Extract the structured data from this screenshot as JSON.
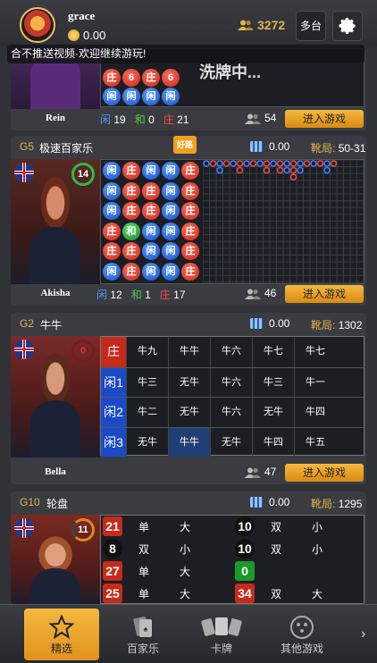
{
  "header": {
    "username": "grace",
    "balance": "0.00",
    "online_count": "3272",
    "multi_table_label": "多台"
  },
  "marquee": "合不推送视频·欢迎继续游玩!",
  "top_card": {
    "banner_text": "洗牌中...",
    "dealer_name": "Rein",
    "player_label": "闲",
    "player_count": "19",
    "tie_label": "和",
    "tie_count": "0",
    "banker_label": "庄",
    "banker_count": "21",
    "players": "54",
    "enter_label": "进入游戏",
    "bead_rows": [
      [
        "庄",
        "6",
        "庄",
        "6"
      ],
      [
        "闲",
        "闲",
        "闲",
        "闲"
      ]
    ]
  },
  "g5": {
    "id": "G5",
    "name": "极速百家乐",
    "badge": "好路",
    "shoe": "0.00",
    "round_label": "靴局:",
    "round": "50-31",
    "dealer_name": "Akisha",
    "timer": "14",
    "player_label": "闲",
    "player_count": "12",
    "tie_label": "和",
    "tie_count": "1",
    "banker_label": "庄",
    "banker_count": "17",
    "players": "46",
    "enter_label": "进入游戏",
    "bead_grid": [
      [
        "闲",
        "庄",
        "闲",
        "闲",
        "庄"
      ],
      [
        "闲",
        "庄",
        "庄",
        "闲",
        "庄"
      ],
      [
        "闲",
        "庄",
        "庄",
        "闲",
        "庄"
      ],
      [
        "庄",
        "和",
        "闲",
        "闲",
        "庄"
      ],
      [
        "庄",
        "庄",
        "闲",
        "闲",
        "庄"
      ],
      [
        "闲",
        "庄",
        "闲",
        "闲",
        "庄"
      ]
    ]
  },
  "g2": {
    "id": "G2",
    "name": "牛牛",
    "shoe": "0.00",
    "round_label": "靴局:",
    "round": "1302",
    "dealer_name": "Bella",
    "timer": "0",
    "players": "47",
    "enter_label": "进入游戏",
    "rows": [
      {
        "label": "庄",
        "cells": [
          "牛九",
          "牛牛",
          "牛六",
          "牛七",
          "牛七"
        ]
      },
      {
        "label": "闲1",
        "cells": [
          "牛三",
          "无牛",
          "牛六",
          "牛三",
          "牛一"
        ]
      },
      {
        "label": "闲2",
        "cells": [
          "牛二",
          "无牛",
          "牛六",
          "无牛",
          "牛四"
        ]
      },
      {
        "label": "闲3",
        "cells": [
          "无牛",
          "牛牛",
          "无牛",
          "牛四",
          "牛五"
        ]
      }
    ]
  },
  "g10": {
    "id": "G10",
    "name": "轮盘",
    "shoe": "0.00",
    "round_label": "靴局:",
    "round": "1295",
    "timer": "11",
    "left_col": [
      {
        "num": "21",
        "color": "red",
        "a": "单",
        "b": "大"
      },
      {
        "num": "8",
        "color": "black",
        "a": "双",
        "b": "小"
      },
      {
        "num": "27",
        "color": "red",
        "a": "单",
        "b": "大"
      },
      {
        "num": "25",
        "color": "red",
        "a": "单",
        "b": "大"
      }
    ],
    "right_col": [
      {
        "num": "10",
        "color": "black",
        "a": "双",
        "b": "小"
      },
      {
        "num": "10",
        "color": "black",
        "a": "双",
        "b": "小"
      },
      {
        "num": "0",
        "color": "green",
        "a": "",
        "b": ""
      },
      {
        "num": "34",
        "color": "red",
        "a": "双",
        "b": "大"
      }
    ]
  },
  "tabs": [
    {
      "label": "精选",
      "icon": "star-icon"
    },
    {
      "label": "百家乐",
      "icon": "cards-icon"
    },
    {
      "label": "卡牌",
      "icon": "card-deck-icon"
    },
    {
      "label": "其他游戏",
      "icon": "dice-icon"
    }
  ],
  "tab_more": "›"
}
